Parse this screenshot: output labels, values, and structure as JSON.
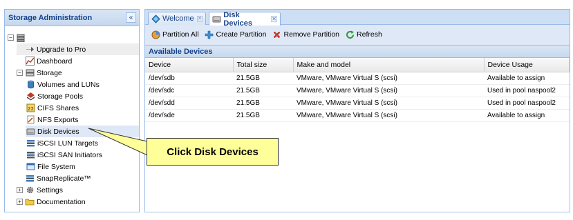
{
  "left_panel": {
    "title": "Storage Administration",
    "collapse_glyph": "«",
    "tree": [
      {
        "label": "",
        "icon": "server-icon",
        "indent": 0,
        "toggle": "−"
      },
      {
        "label": "Upgrade to Pro",
        "icon": "arrow-icon",
        "indent": 1,
        "toggle": ""
      },
      {
        "label": "Dashboard",
        "icon": "chart-icon",
        "indent": 1,
        "toggle": ""
      },
      {
        "label": "Storage",
        "icon": "storage-icon",
        "indent": 1,
        "toggle": "−"
      },
      {
        "label": "Volumes and LUNs",
        "icon": "cylinder-icon",
        "indent": 2,
        "toggle": ""
      },
      {
        "label": "Storage Pools",
        "icon": "pool-icon",
        "indent": 2,
        "toggle": ""
      },
      {
        "label": "CIFS Shares",
        "icon": "cifs-icon",
        "indent": 2,
        "toggle": ""
      },
      {
        "label": "NFS Exports",
        "icon": "nfs-icon",
        "indent": 2,
        "toggle": ""
      },
      {
        "label": "Disk Devices",
        "icon": "disk-icon",
        "indent": 2,
        "toggle": ""
      },
      {
        "label": "iSCSI LUN Targets",
        "icon": "target-icon",
        "indent": 2,
        "toggle": ""
      },
      {
        "label": "iSCSI SAN Initiators",
        "icon": "initiator-icon",
        "indent": 2,
        "toggle": ""
      },
      {
        "label": "File System",
        "icon": "filesystem-icon",
        "indent": 2,
        "toggle": ""
      },
      {
        "label": "SnapReplicate™",
        "icon": "snapreplicate-icon",
        "indent": 1,
        "toggle": ""
      },
      {
        "label": "Settings",
        "icon": "gear-icon",
        "indent": 1,
        "toggle": "+"
      },
      {
        "label": "Documentation",
        "icon": "folder-icon",
        "indent": 1,
        "toggle": "+"
      }
    ]
  },
  "tabs": [
    {
      "label": "Welcome",
      "icon": "welcome-icon",
      "active": false
    },
    {
      "label": "Disk Devices",
      "icon": "disk-icon",
      "active": true
    }
  ],
  "toolbar": {
    "partition_all": "Partition All",
    "create_partition": "Create Partition",
    "remove_partition": "Remove Partition",
    "refresh": "Refresh"
  },
  "grid": {
    "title": "Available Devices",
    "columns": [
      "Device",
      "Total size",
      "Make and model",
      "Device Usage"
    ],
    "rows": [
      [
        "/dev/sdb",
        "21.5GB",
        "VMware, VMware Virtual S (scsi)",
        "Available to assign"
      ],
      [
        "/dev/sdc",
        "21.5GB",
        "VMware, VMware Virtual S (scsi)",
        "Used in pool naspool2"
      ],
      [
        "/dev/sdd",
        "21.5GB",
        "VMware, VMware Virtual S (scsi)",
        "Used in pool naspool2"
      ],
      [
        "/dev/sde",
        "21.5GB",
        "VMware, VMware Virtual S (scsi)",
        "Available to assign"
      ]
    ]
  },
  "callout": {
    "text": "Click Disk Devices"
  },
  "colors": {
    "panel_border": "#99bbe8",
    "header_text": "#15428b",
    "callout_bg": "#ffff99"
  }
}
